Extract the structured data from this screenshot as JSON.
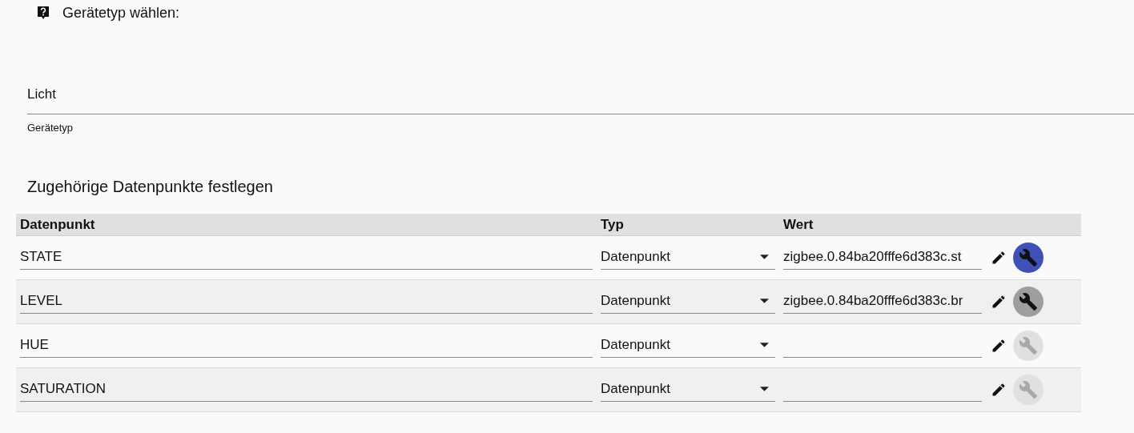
{
  "prompt": {
    "title": "Gerätetyp wählen:"
  },
  "device_type": {
    "value": "Licht",
    "label": "Gerätetyp"
  },
  "section_title": "Zugehörige Datenpunkte festlegen",
  "table": {
    "columns": [
      "Datenpunkt",
      "Typ",
      "Wert"
    ],
    "rows": [
      {
        "name": "STATE",
        "type": "Datenpunkt",
        "value": "zigbee.0.84ba20fffe6d383c.st",
        "settings_primary": true,
        "settings_disabled": false
      },
      {
        "name": "LEVEL",
        "type": "Datenpunkt",
        "value": "zigbee.0.84ba20fffe6d383c.br",
        "settings_primary": false,
        "settings_disabled": false
      },
      {
        "name": "HUE",
        "type": "Datenpunkt",
        "settings_primary": false,
        "settings_disabled": true
      },
      {
        "name": "SATURATION",
        "type": "Datenpunkt",
        "settings_primary": false,
        "settings_disabled": true
      }
    ]
  }
}
